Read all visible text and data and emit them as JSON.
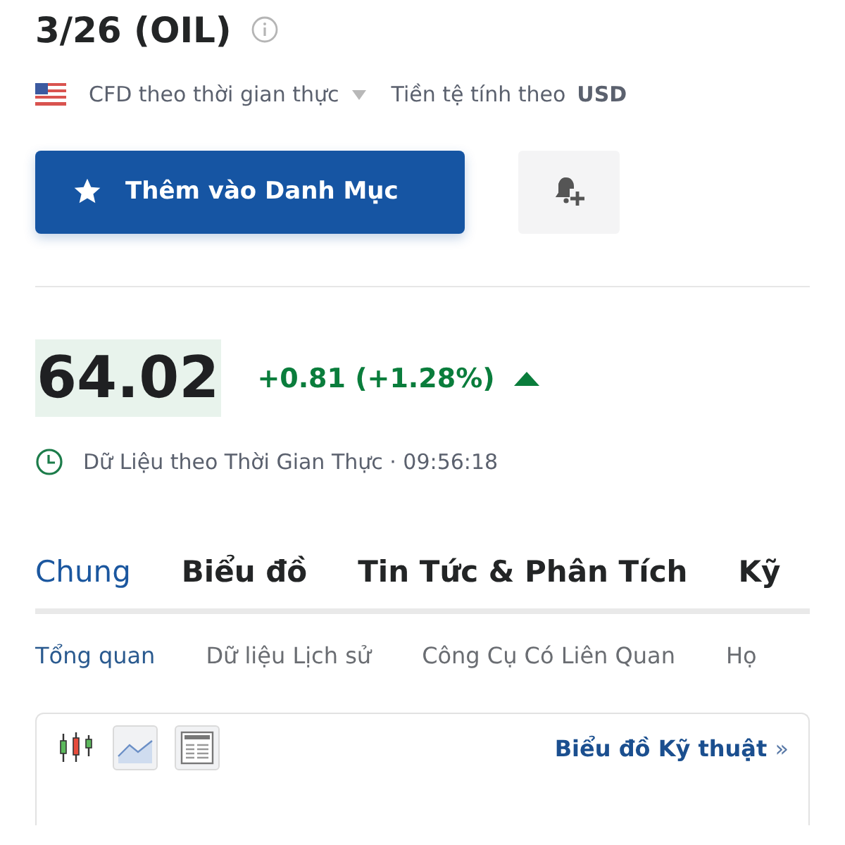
{
  "instrument": {
    "title": "3/26 (OIL)",
    "market": "CFD theo thời gian thực",
    "currency_label": "Tiền tệ tính theo",
    "currency": "USD"
  },
  "actions": {
    "watchlist_button": "Thêm vào Danh Mục"
  },
  "quote": {
    "price": "64.02",
    "change": "+0.81 (+1.28%)",
    "rising": true,
    "time_label": "Dữ Liệu theo Thời Gian Thực · 09:56:18"
  },
  "tabs": [
    {
      "label": "Chung",
      "selected": true
    },
    {
      "label": "Biểu đồ",
      "selected": false
    },
    {
      "label": "Tin Tức & Phân Tích",
      "selected": false
    },
    {
      "label": "Kỹ",
      "selected": false
    }
  ],
  "subtabs": [
    {
      "label": "Tổng quan",
      "selected": true
    },
    {
      "label": "Dữ liệu Lịch sử",
      "selected": false
    },
    {
      "label": "Công Cụ Có Liên Quan",
      "selected": false
    },
    {
      "label": "Họ",
      "selected": false
    }
  ],
  "chart_panel": {
    "chart_types": [
      {
        "kind": "candles"
      },
      {
        "kind": "line"
      },
      {
        "kind": "table"
      }
    ],
    "link": "Biểu đồ Kỹ thuật",
    "link_arrow": "»"
  }
}
